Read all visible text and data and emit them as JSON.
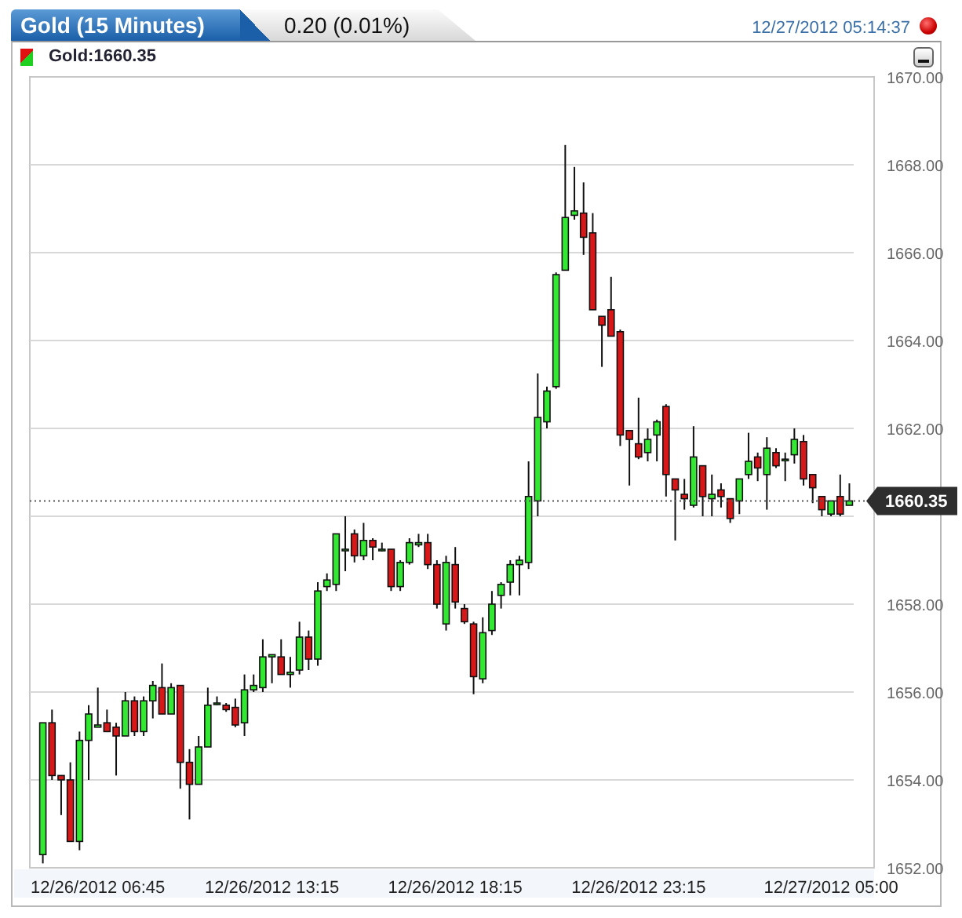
{
  "header": {
    "title_tab": "Gold (15 Minutes)",
    "change": "0.20 (0.01%)",
    "timestamp": "12/27/2012 05:14:37"
  },
  "legend": {
    "label": "Gold:1660.35"
  },
  "chart": {
    "chart_data": {
      "type": "candlestick",
      "ylim": [
        1652,
        1670
      ],
      "grid": true,
      "ref_lines": [
        {
          "axis": "y",
          "value": 1660.35,
          "label": "1660.35"
        }
      ],
      "yticks": [
        {
          "value": 1652,
          "label": "1652.00"
        },
        {
          "value": 1654,
          "label": "1654.00"
        },
        {
          "value": 1656,
          "label": "1656.00"
        },
        {
          "value": 1658,
          "label": "1658.00"
        },
        {
          "value": 1662,
          "label": "1662.00"
        },
        {
          "value": 1664,
          "label": "1664.00"
        },
        {
          "value": 1666,
          "label": "1666.00"
        },
        {
          "value": 1668,
          "label": "1668.00"
        },
        {
          "value": 1670,
          "label": "1670.00"
        }
      ],
      "categories": [
        null,
        null,
        null,
        null,
        null,
        null,
        "12/26/2012 06:45",
        null,
        null,
        null,
        null,
        null,
        null,
        null,
        null,
        null,
        null,
        null,
        null,
        null,
        null,
        null,
        null,
        null,
        null,
        "12/26/2012 13:15",
        null,
        null,
        null,
        null,
        null,
        null,
        null,
        null,
        null,
        null,
        null,
        null,
        null,
        null,
        null,
        null,
        null,
        null,
        null,
        "12/26/2012 18:15",
        null,
        null,
        null,
        null,
        null,
        null,
        null,
        null,
        null,
        null,
        null,
        null,
        null,
        null,
        null,
        null,
        null,
        null,
        null,
        "12/26/2012 23:15",
        null,
        null,
        null,
        null,
        null,
        null,
        null,
        null,
        null,
        null,
        null,
        null,
        null,
        null,
        null,
        null,
        null,
        null,
        null,
        null,
        "12/27/2012 05:00",
        null,
        null
      ],
      "ohlc": [
        [
          1652.3,
          1655.3,
          1652.1,
          1655.3
        ],
        [
          1655.3,
          1655.6,
          1654.0,
          1654.1
        ],
        [
          1654.1,
          1654.1,
          1653.2,
          1654.0
        ],
        [
          1654.0,
          1654.4,
          1652.6,
          1652.6
        ],
        [
          1652.6,
          1655.1,
          1652.4,
          1654.9
        ],
        [
          1654.9,
          1655.7,
          1654.0,
          1655.5
        ],
        [
          1655.2,
          1656.1,
          1655.2,
          1655.25
        ],
        [
          1655.3,
          1655.6,
          1655.1,
          1655.1
        ],
        [
          1655.2,
          1655.3,
          1654.1,
          1655.0
        ],
        [
          1655.0,
          1656.0,
          1655.0,
          1655.8
        ],
        [
          1655.8,
          1655.9,
          1655.0,
          1655.1
        ],
        [
          1655.1,
          1655.9,
          1655.0,
          1655.8
        ],
        [
          1655.8,
          1656.25,
          1655.4,
          1656.15
        ],
        [
          1656.1,
          1656.65,
          1655.5,
          1655.5
        ],
        [
          1655.5,
          1656.2,
          1655.5,
          1656.1
        ],
        [
          1656.15,
          1656.15,
          1653.8,
          1654.4
        ],
        [
          1654.4,
          1654.7,
          1653.1,
          1653.9
        ],
        [
          1653.9,
          1655.0,
          1653.9,
          1654.75
        ],
        [
          1654.75,
          1656.1,
          1654.75,
          1655.7
        ],
        [
          1655.75,
          1655.9,
          1655.7,
          1655.75
        ],
        [
          1655.7,
          1655.75,
          1655.55,
          1655.6
        ],
        [
          1655.65,
          1655.85,
          1655.2,
          1655.25
        ],
        [
          1655.3,
          1656.4,
          1655.0,
          1656.05
        ],
        [
          1656.05,
          1656.4,
          1656.0,
          1656.15
        ],
        [
          1656.1,
          1657.2,
          1656.0,
          1656.8
        ],
        [
          1656.8,
          1656.85,
          1656.2,
          1656.85
        ],
        [
          1656.8,
          1657.2,
          1656.4,
          1656.4
        ],
        [
          1656.4,
          1656.8,
          1656.1,
          1656.45
        ],
        [
          1656.5,
          1657.6,
          1656.4,
          1657.25
        ],
        [
          1657.25,
          1657.4,
          1656.5,
          1656.75
        ],
        [
          1656.75,
          1658.5,
          1656.6,
          1658.3
        ],
        [
          1658.4,
          1658.7,
          1658.3,
          1658.55
        ],
        [
          1658.45,
          1659.6,
          1658.3,
          1659.6
        ],
        [
          1659.25,
          1660.0,
          1658.75,
          1659.25
        ],
        [
          1659.6,
          1659.7,
          1658.95,
          1659.1
        ],
        [
          1659.1,
          1659.85,
          1659.0,
          1659.45
        ],
        [
          1659.45,
          1659.5,
          1659.0,
          1659.3
        ],
        [
          1659.25,
          1659.4,
          1659.2,
          1659.25
        ],
        [
          1659.25,
          1659.25,
          1658.3,
          1658.4
        ],
        [
          1658.4,
          1659.0,
          1658.3,
          1658.95
        ],
        [
          1658.95,
          1659.5,
          1658.9,
          1659.4
        ],
        [
          1659.35,
          1659.6,
          1659.3,
          1659.4
        ],
        [
          1659.4,
          1659.6,
          1658.8,
          1658.9
        ],
        [
          1658.9,
          1659.0,
          1657.9,
          1658.0
        ],
        [
          1657.55,
          1659.1,
          1657.4,
          1658.95
        ],
        [
          1658.9,
          1659.3,
          1657.9,
          1658.05
        ],
        [
          1657.9,
          1658.0,
          1657.55,
          1657.6
        ],
        [
          1657.55,
          1657.6,
          1655.95,
          1656.35
        ],
        [
          1656.3,
          1657.7,
          1656.2,
          1657.35
        ],
        [
          1657.4,
          1658.3,
          1657.3,
          1658.0
        ],
        [
          1658.2,
          1658.5,
          1657.9,
          1658.45
        ],
        [
          1658.5,
          1659.0,
          1658.2,
          1658.9
        ],
        [
          1658.9,
          1659.1,
          1658.2,
          1659.0
        ],
        [
          1658.95,
          1661.25,
          1658.8,
          1660.45
        ],
        [
          1660.35,
          1663.25,
          1660.0,
          1662.25
        ],
        [
          1662.15,
          1662.95,
          1662.0,
          1662.85
        ],
        [
          1662.95,
          1665.55,
          1662.9,
          1665.5
        ],
        [
          1665.6,
          1668.45,
          1665.6,
          1666.8
        ],
        [
          1666.85,
          1667.95,
          1666.75,
          1666.95
        ],
        [
          1666.9,
          1667.6,
          1665.95,
          1666.35
        ],
        [
          1666.45,
          1666.9,
          1664.7,
          1664.7
        ],
        [
          1664.55,
          1664.55,
          1663.4,
          1664.35
        ],
        [
          1664.7,
          1665.45,
          1664.1,
          1664.1
        ],
        [
          1664.2,
          1664.25,
          1661.6,
          1661.85
        ],
        [
          1661.95,
          1661.95,
          1660.7,
          1661.75
        ],
        [
          1661.65,
          1662.7,
          1661.3,
          1661.35
        ],
        [
          1661.45,
          1662.0,
          1661.25,
          1661.75
        ],
        [
          1661.85,
          1662.2,
          1661.25,
          1662.15
        ],
        [
          1662.5,
          1662.55,
          1660.45,
          1660.95
        ],
        [
          1660.85,
          1660.85,
          1659.45,
          1660.6
        ],
        [
          1660.5,
          1660.85,
          1660.15,
          1660.4
        ],
        [
          1660.25,
          1662.05,
          1660.2,
          1661.35
        ],
        [
          1661.15,
          1661.15,
          1660.0,
          1660.45
        ],
        [
          1660.4,
          1660.95,
          1660.0,
          1660.5
        ],
        [
          1660.6,
          1660.75,
          1660.2,
          1660.45
        ],
        [
          1660.4,
          1660.4,
          1659.85,
          1659.95
        ],
        [
          1660.35,
          1660.85,
          1660.05,
          1660.85
        ],
        [
          1660.95,
          1661.9,
          1660.85,
          1661.25
        ],
        [
          1661.35,
          1661.45,
          1660.8,
          1661.1
        ],
        [
          1660.95,
          1661.8,
          1660.15,
          1661.55
        ],
        [
          1661.45,
          1661.55,
          1661.1,
          1661.15
        ],
        [
          1661.3,
          1661.45,
          1660.8,
          1661.3
        ],
        [
          1661.4,
          1662.0,
          1661.2,
          1661.75
        ],
        [
          1661.7,
          1661.85,
          1660.7,
          1660.85
        ],
        [
          1660.95,
          1660.95,
          1660.3,
          1660.65
        ],
        [
          1660.45,
          1660.45,
          1660.0,
          1660.15
        ],
        [
          1660.05,
          1660.35,
          1660.0,
          1660.35
        ],
        [
          1660.45,
          1660.95,
          1660.0,
          1660.05
        ],
        [
          1660.25,
          1660.75,
          1660.25,
          1660.35
        ]
      ]
    }
  }
}
